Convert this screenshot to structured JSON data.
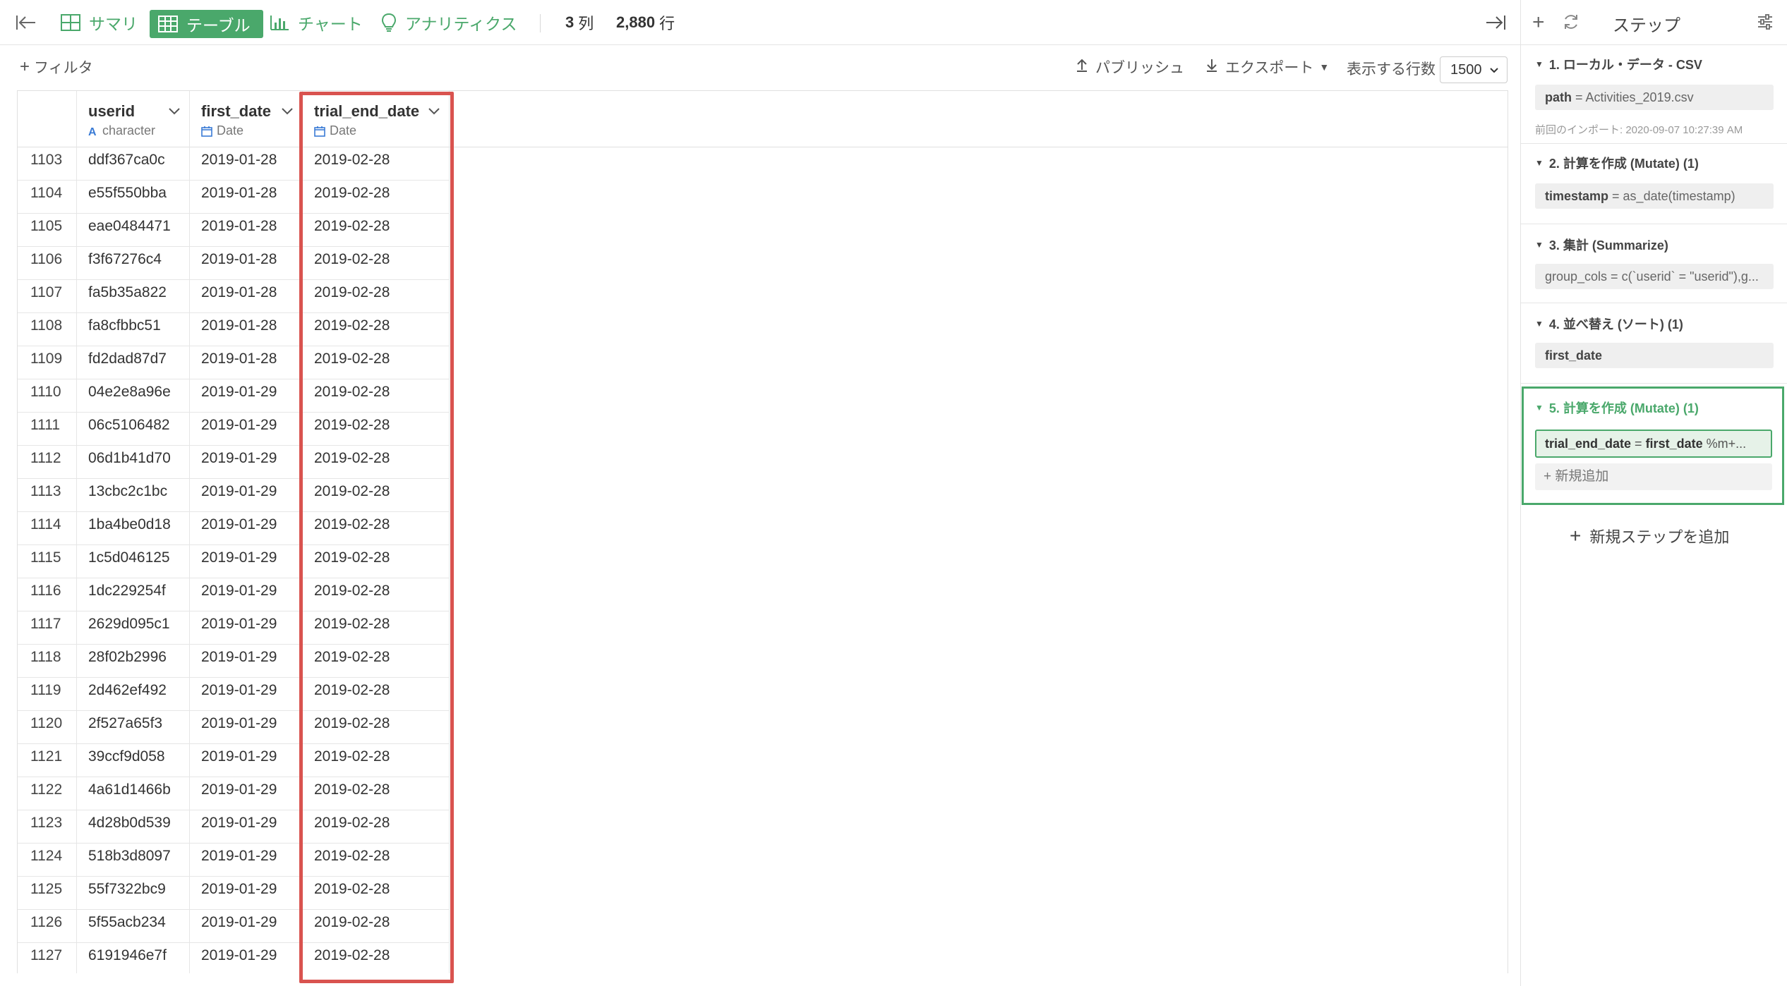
{
  "toolbar": {
    "tabs": [
      {
        "label": "サマリ",
        "icon": "grid-icon"
      },
      {
        "label": "テーブル",
        "icon": "table-icon",
        "active": true
      },
      {
        "label": "チャート",
        "icon": "bar-chart-icon"
      },
      {
        "label": "アナリティクス",
        "icon": "lightbulb-icon"
      }
    ],
    "col_count": "3",
    "col_unit": "列",
    "row_count": "2,880",
    "row_unit": "行"
  },
  "subtoolbar": {
    "filter_label": "フィルタ",
    "publish_label": "パブリッシュ",
    "export_label": "エクスポート",
    "rows_label": "表示する行数",
    "rows_value": "1500"
  },
  "table": {
    "columns": [
      {
        "name": "userid",
        "type": "character"
      },
      {
        "name": "first_date",
        "type": "Date"
      },
      {
        "name": "trial_end_date",
        "type": "Date"
      }
    ],
    "rows": [
      [
        "1103",
        "ddf367ca0c",
        "2019-01-28",
        "2019-02-28"
      ],
      [
        "1104",
        "e55f550bba",
        "2019-01-28",
        "2019-02-28"
      ],
      [
        "1105",
        "eae0484471",
        "2019-01-28",
        "2019-02-28"
      ],
      [
        "1106",
        "f3f67276c4",
        "2019-01-28",
        "2019-02-28"
      ],
      [
        "1107",
        "fa5b35a822",
        "2019-01-28",
        "2019-02-28"
      ],
      [
        "1108",
        "fa8cfbbc51",
        "2019-01-28",
        "2019-02-28"
      ],
      [
        "1109",
        "fd2dad87d7",
        "2019-01-28",
        "2019-02-28"
      ],
      [
        "1110",
        "04e2e8a96e",
        "2019-01-29",
        "2019-02-28"
      ],
      [
        "1111",
        "06c5106482",
        "2019-01-29",
        "2019-02-28"
      ],
      [
        "1112",
        "06d1b41d70",
        "2019-01-29",
        "2019-02-28"
      ],
      [
        "1113",
        "13cbc2c1bc",
        "2019-01-29",
        "2019-02-28"
      ],
      [
        "1114",
        "1ba4be0d18",
        "2019-01-29",
        "2019-02-28"
      ],
      [
        "1115",
        "1c5d046125",
        "2019-01-29",
        "2019-02-28"
      ],
      [
        "1116",
        "1dc229254f",
        "2019-01-29",
        "2019-02-28"
      ],
      [
        "1117",
        "2629d095c1",
        "2019-01-29",
        "2019-02-28"
      ],
      [
        "1118",
        "28f02b2996",
        "2019-01-29",
        "2019-02-28"
      ],
      [
        "1119",
        "2d462ef492",
        "2019-01-29",
        "2019-02-28"
      ],
      [
        "1120",
        "2f527a65f3",
        "2019-01-29",
        "2019-02-28"
      ],
      [
        "1121",
        "39ccf9d058",
        "2019-01-29",
        "2019-02-28"
      ],
      [
        "1122",
        "4a61d1466b",
        "2019-01-29",
        "2019-02-28"
      ],
      [
        "1123",
        "4d28b0d539",
        "2019-01-29",
        "2019-02-28"
      ],
      [
        "1124",
        "518b3d8097",
        "2019-01-29",
        "2019-02-28"
      ],
      [
        "1125",
        "55f7322bc9",
        "2019-01-29",
        "2019-02-28"
      ],
      [
        "1126",
        "5f55acb234",
        "2019-01-29",
        "2019-02-28"
      ],
      [
        "1127",
        "6191946e7f",
        "2019-01-29",
        "2019-02-28"
      ]
    ]
  },
  "steps_panel": {
    "title": "ステップ",
    "steps": [
      {
        "title": "1. ローカル・データ - CSV",
        "key": "path",
        "expr": " = Activities_2019.csv",
        "meta": "前回のインポート: 2020-09-07 10:27:39 AM"
      },
      {
        "title": "2. 計算を作成 (Mutate) (1)",
        "key": "timestamp",
        "expr": " = as_date(timestamp)"
      },
      {
        "title": "3. 集計 (Summarize)",
        "key": "",
        "expr": "group_cols = c(`userid` = \"userid\"),g..."
      },
      {
        "title": "4. 並べ替え (ソート) (1)",
        "key": "first_date",
        "expr": ""
      },
      {
        "title": "5. 計算を作成 (Mutate) (1)",
        "key": "trial_end_date",
        "expr": " = ",
        "key2": "first_date",
        "expr2": " %m+...",
        "add_label": "新規追加"
      }
    ],
    "add_step_label": "新規ステップを追加"
  },
  "colors": {
    "accent": "#4aa86b",
    "highlight": "#d9534f"
  }
}
